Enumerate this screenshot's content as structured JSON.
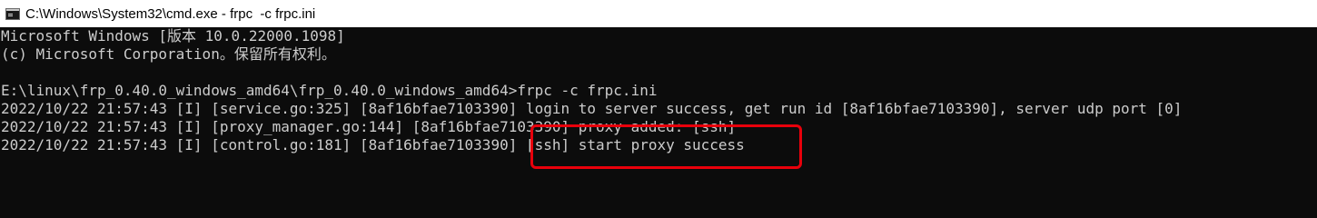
{
  "window": {
    "title": "C:\\Windows\\System32\\cmd.exe - frpc  -c frpc.ini",
    "icon": "cmd-icon"
  },
  "console": {
    "lines": [
      "Microsoft Windows [版本 10.0.22000.1098]",
      "(c) Microsoft Corporation。保留所有权利。",
      "",
      "E:\\linux\\frp_0.40.0_windows_amd64\\frp_0.40.0_windows_amd64>frpc -c frpc.ini",
      "2022/10/22 21:57:43 [I] [service.go:325] [8af16bfae7103390] login to server success, get run id [8af16bfae7103390], server udp port [0]",
      "2022/10/22 21:57:43 [I] [proxy_manager.go:144] [8af16bfae7103390] proxy added: [ssh]",
      "2022/10/22 21:57:43 [I] [control.go:181] [8af16bfae7103390] [ssh] start proxy success"
    ]
  },
  "colors": {
    "console_background": "#0c0c0c",
    "console_text": "#cccccc",
    "titlebar_background": "#ffffff",
    "annotation_box": "#e8000b"
  }
}
